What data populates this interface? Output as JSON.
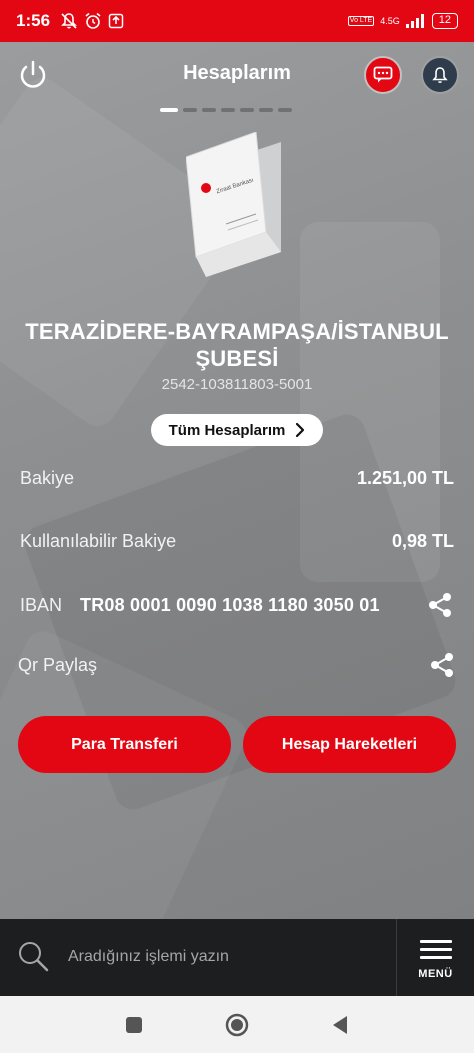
{
  "status_bar": {
    "time": "1:56",
    "network": "4.5G",
    "volte": "Vo LTE",
    "battery": "12"
  },
  "header": {
    "title": "Hesaplarım"
  },
  "pager": {
    "pages": 7,
    "active_index": 0
  },
  "card": {
    "bank_name": "Ziraat Bankası"
  },
  "account": {
    "branch_name": "TERAZİDERE-BAYRAMPAŞA/İSTANBUL ŞUBESİ",
    "account_number": "2542-103811803-5001",
    "all_accounts_label": "Tüm Hesaplarım",
    "balance_label": "Bakiye",
    "balance_value": "1.251,00 TL",
    "available_label": "Kullanılabilir Bakiye",
    "available_value": "0,98 TL",
    "iban_label": "IBAN",
    "iban_value": "TR08 0001 0090 1038 1180 3050 01",
    "qr_label": "Qr Paylaş"
  },
  "actions": {
    "transfer_label": "Para Transferi",
    "transactions_label": "Hesap Hareketleri"
  },
  "search": {
    "placeholder": "Aradığınız işlemi yazın",
    "menu_label": "MENÜ"
  },
  "colors": {
    "brand_red": "#e30613",
    "background_gray": "#8e9092",
    "search_bar": "#1d1e20"
  }
}
